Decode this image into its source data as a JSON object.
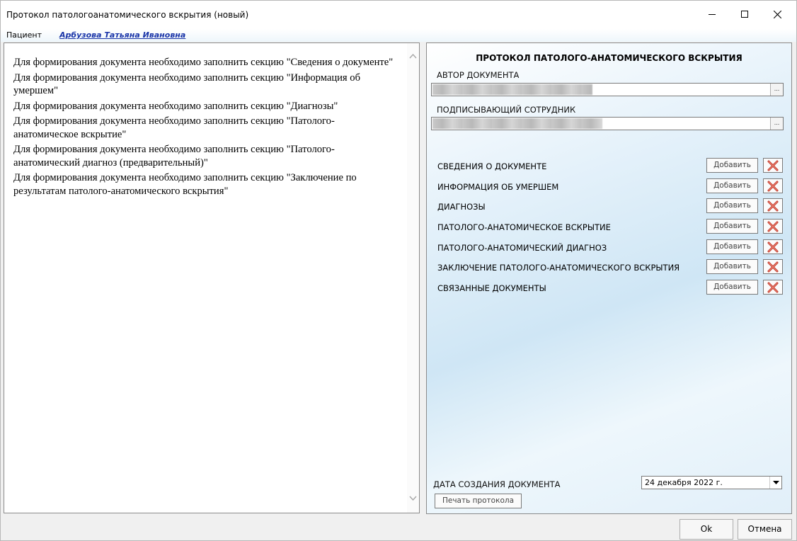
{
  "window": {
    "title": "Протокол патологоанатомического вскрытия (новый)"
  },
  "patient": {
    "label": "Пациент",
    "name": "Арбузова Татьяна Ивановна"
  },
  "messages": [
    "Для формирования документа необходимо заполнить секцию \"Сведения о документе\"",
    "Для формирования документа необходимо заполнить секцию \"Информация об умершем\"",
    "Для формирования документа необходимо заполнить секцию \"Диагнозы\"",
    "Для формирования документа необходимо заполнить секцию \"Патолого-анатомическое вскрытие\"",
    "Для формирования документа необходимо заполнить секцию \"Патолого-анатомический диагноз (предварительный)\"",
    "Для формирования документа необходимо заполнить секцию \"Заключение по результатам патолого-анатомического вскрытия\""
  ],
  "protocol": {
    "title": "ПРОТОКОЛ ПАТОЛОГО-АНАТОМИЧЕСКОГО ВСКРЫТИЯ",
    "author_label": "АВТОР ДОКУМЕНТА",
    "signer_label": "ПОДПИСЫВАЮЩИЙ СОТРУДНИК",
    "browse_label": "...",
    "sections": [
      {
        "label": "СВЕДЕНИЯ О ДОКУМЕНТЕ",
        "add": "Добавить"
      },
      {
        "label": "ИНФОРМАЦИЯ ОБ УМЕРШЕМ",
        "add": "Добавить"
      },
      {
        "label": "ДИАГНОЗЫ",
        "add": "Добавить"
      },
      {
        "label": "ПАТОЛОГО-АНАТОМИЧЕСКОЕ ВСКРЫТИЕ",
        "add": "Добавить"
      },
      {
        "label": "ПАТОЛОГО-АНАТОМИЧЕСКИЙ ДИАГНОЗ",
        "add": "Добавить"
      },
      {
        "label": "ЗАКЛЮЧЕНИЕ ПАТОЛОГО-АНАТОМИЧЕСКОГО ВСКРЫТИЯ",
        "add": "Добавить"
      },
      {
        "label": "СВЯЗАННЫЕ ДОКУМЕНТЫ",
        "add": "Добавить"
      }
    ],
    "date_label": "ДАТА СОЗДАНИЯ ДОКУМЕНТА",
    "date_value": "24 декабря  2022 г.",
    "print_label": "Печать протокола"
  },
  "footer": {
    "ok": "Ok",
    "cancel": "Отмена"
  }
}
